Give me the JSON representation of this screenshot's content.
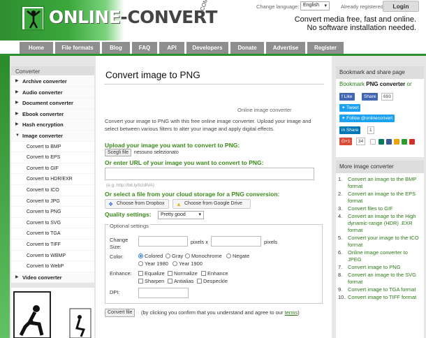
{
  "header": {
    "logo_text_left": "ONLINE",
    "logo_text_dash": "-",
    "logo_text_right": "CONVERT",
    "logo_com": ".COM",
    "change_language_label": "Change language:",
    "language_value": "English",
    "already_registered": "Already registered?",
    "login_label": "Login",
    "tagline_line1": "Convert media free, fast and online.",
    "tagline_line2": "No software installation needed."
  },
  "nav": {
    "items": [
      {
        "label": "Home"
      },
      {
        "label": "File formats"
      },
      {
        "label": "Blog"
      },
      {
        "label": "FAQ"
      },
      {
        "label": "API"
      },
      {
        "label": "Developers"
      },
      {
        "label": "Donate"
      },
      {
        "label": "Advertise"
      },
      {
        "label": "Register"
      }
    ]
  },
  "sidebar": {
    "heading": "Converter",
    "categories": [
      {
        "label": "Archive converter"
      },
      {
        "label": "Audio converter"
      },
      {
        "label": "Document converter"
      },
      {
        "label": "Ebook converter"
      },
      {
        "label": "Hash encryption"
      },
      {
        "label": "Image converter"
      }
    ],
    "image_items": [
      {
        "label": "Convert to BMP"
      },
      {
        "label": "Convert to EPS"
      },
      {
        "label": "Convert to GIF"
      },
      {
        "label": "Convert to HDR/EXR"
      },
      {
        "label": "Convert to ICO"
      },
      {
        "label": "Convert to JPG"
      },
      {
        "label": "Convert to PNG"
      },
      {
        "label": "Convert to SVG"
      },
      {
        "label": "Convert to TGA"
      },
      {
        "label": "Convert to TIFF"
      },
      {
        "label": "Convert to WBMP"
      },
      {
        "label": "Convert to WebP"
      }
    ],
    "video_converter": "Video converter"
  },
  "main": {
    "title": "Convert image to PNG",
    "image_converter_label": "Online image converter",
    "description": "Convert your image to PNG with this free online image converter. Upload your image and select between various filters to alter your image and apply digital effects.",
    "upload_label": "Upload your image you want to convert to PNG:",
    "choose_file_button": "Scegli file",
    "no_file_selected": "nessuno selezionato",
    "url_label": "Or enter URL of your image you want to convert to PNG:",
    "url_placeholder": "",
    "url_hint": "(e.g. http://bit.ly/b2dlVA)",
    "cloud_label": "Or select a file from your cloud storage for a PNG conversion:",
    "dropbox_button": "Choose from Dropbox",
    "gdrive_button": "Choose from Google Drive",
    "quality_label": "Quality settings:",
    "quality_value": "Pretty good",
    "optional_settings": "Optional settings",
    "change_size_label": "Change Size:",
    "pixels_x": "pixels x",
    "pixels": "pixels",
    "color_label": "Color:",
    "color_options": {
      "colored": "Colored",
      "gray": "Gray",
      "monochrome": "Monochrome",
      "negate": "Negate",
      "year1980": "Year 1980",
      "year1900": "Year 1900"
    },
    "enhance_label": "Enhance:",
    "enhance_options": {
      "equalize": "Equalize",
      "normalize": "Normalize",
      "enhance": "Enhance",
      "sharpen": "Sharpen",
      "antialias": "Antialias",
      "despeckle": "Despeckle"
    },
    "dpi_label": "DPI:",
    "convert_button": "Convert file",
    "convert_note": "(by clicking you confirm that you understand and agree to our",
    "terms_link": "terms",
    "convert_note_end": ")"
  },
  "right": {
    "bookmark_heading": "Bookmark and share page",
    "bookmark_text_prefix": "Bookmark",
    "bookmark_text_bold": "PNG converter",
    "bookmark_text_suffix": "or",
    "fb_like": "Like",
    "fb_share": "Share",
    "fb_count": "693",
    "tweet": "Tweet",
    "follow": "Follow @onlineconvert",
    "in_share": "Share",
    "in_count": "1",
    "gplus": "G+1",
    "gplus_count": "34",
    "more_heading": "More image converter",
    "more_items": [
      {
        "n": "1.",
        "label": "Convert an image to the BMP format"
      },
      {
        "n": "2.",
        "label": "Convert an image to the EPS format"
      },
      {
        "n": "3.",
        "label": "Convert files to GIF"
      },
      {
        "n": "4.",
        "label": "Convert an image to the High dynamic-range (HDR) .EXR format"
      },
      {
        "n": "5.",
        "label": "Convert your image to the ICO format"
      },
      {
        "n": "6.",
        "label": "Online image converter to JPEG"
      },
      {
        "n": "7.",
        "label": "Convert image to PNG"
      },
      {
        "n": "8.",
        "label": "Convert an image to the SVG format"
      },
      {
        "n": "9.",
        "label": "Convert image to TGA format"
      },
      {
        "n": "10.",
        "label": "Convert image to TIFF format"
      }
    ]
  },
  "colors": {
    "brand_green": "#2f8f30",
    "link_green": "#2a7b15",
    "nav_gray": "#8e8e8e"
  }
}
